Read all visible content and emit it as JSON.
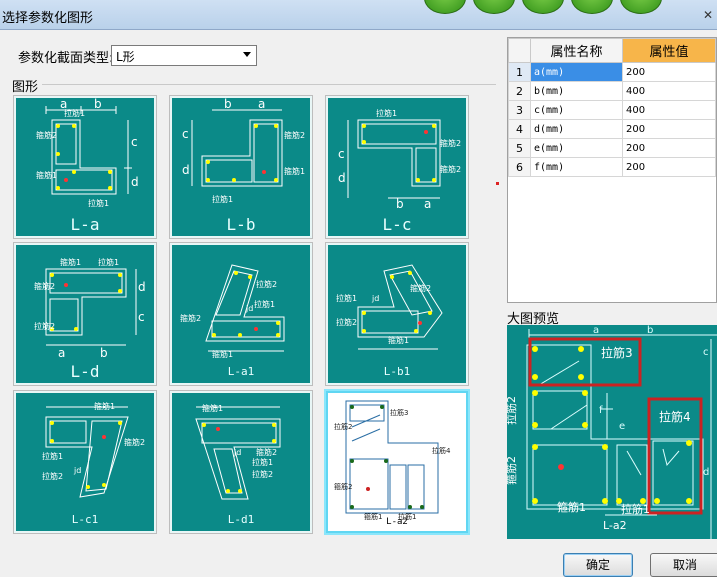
{
  "window": {
    "title": "选择参数化图形"
  },
  "section_type": {
    "label": "参数化截面类型:",
    "selected": "L形"
  },
  "graphics_group": {
    "label": "图形"
  },
  "thumbnails": [
    {
      "id": "L-a",
      "label": "L-a",
      "dims": [
        "a",
        "b",
        "c",
        "d"
      ],
      "notes": [
        "拉筋1",
        "箍筋2",
        "箍筋1",
        "拉筋1"
      ]
    },
    {
      "id": "L-b",
      "label": "L-b",
      "dims": [
        "b",
        "a",
        "c",
        "d"
      ],
      "notes": [
        "拉筋1",
        "箍筋2",
        "箍筋1"
      ]
    },
    {
      "id": "L-c",
      "label": "L-c",
      "dims": [
        "b",
        "a",
        "c",
        "d"
      ],
      "notes": [
        "拉筋1",
        "箍筋2",
        "箍筋1"
      ]
    },
    {
      "id": "L-d",
      "label": "L-d",
      "dims": [
        "a",
        "b",
        "c",
        "d"
      ],
      "notes": [
        "箍筋1",
        "拉筋1",
        "箍筋2",
        "拉筋2"
      ]
    },
    {
      "id": "L-a1",
      "label": "L-a1",
      "dims": [
        "a",
        "b",
        "c",
        "d"
      ],
      "notes": [
        "拉筋2",
        "拉筋1",
        "箍筋2",
        "jd",
        "箍筋1"
      ]
    },
    {
      "id": "L-b1",
      "label": "L-b1",
      "dims": [
        "a",
        "b",
        "c",
        "d"
      ],
      "notes": [
        "箍筋2",
        "jd",
        "拉筋1",
        "拉筋2",
        "箍筋1"
      ]
    },
    {
      "id": "L-c1",
      "label": "L-c1",
      "dims": [
        "a",
        "b",
        "c",
        "d"
      ],
      "notes": [
        "箍筋1",
        "箍筋2",
        "拉筋1",
        "jd",
        "拉筋2"
      ]
    },
    {
      "id": "L-d1",
      "label": "L-d1",
      "dims": [
        "a",
        "b",
        "c",
        "d"
      ],
      "notes": [
        "箍筋1",
        "箍筋2",
        "jd",
        "拉筋1",
        "拉筋2"
      ]
    },
    {
      "id": "L-a2",
      "label": "L-a2",
      "dims": [
        "a",
        "b",
        "c",
        "d",
        "e",
        "f"
      ],
      "notes": [
        "拉筋3",
        "拉筋2",
        "箍筋2",
        "拉筋4",
        "箍筋1",
        "拉筋1"
      ]
    }
  ],
  "property_table": {
    "headers": [
      "属性名称",
      "属性值"
    ],
    "rows": [
      {
        "index": "1",
        "name": "a(mm)",
        "value": "200"
      },
      {
        "index": "2",
        "name": "b(mm)",
        "value": "400"
      },
      {
        "index": "3",
        "name": "c(mm)",
        "value": "400"
      },
      {
        "index": "4",
        "name": "d(mm)",
        "value": "200"
      },
      {
        "index": "5",
        "name": "e(mm)",
        "value": "200"
      },
      {
        "index": "6",
        "name": "f(mm)",
        "value": "200"
      }
    ]
  },
  "preview": {
    "label": "大图预览",
    "annotations": [
      "拉筋3",
      "拉筋4",
      "拉筋2",
      "箍筋2",
      "箍筋1",
      "拉筋1",
      "L-a2"
    ],
    "dims": [
      "b",
      "a",
      "f",
      "e",
      "c",
      "d"
    ]
  },
  "buttons": {
    "ok": "确定",
    "cancel": "取消"
  },
  "colors": {
    "panel_bg": "#0b8a88",
    "rebar_line": "#ffffff",
    "bar_dot": "#ffff00",
    "highlight": "#cc2222",
    "value_header": "#f7b54a",
    "selection": "#3a8ee6"
  }
}
